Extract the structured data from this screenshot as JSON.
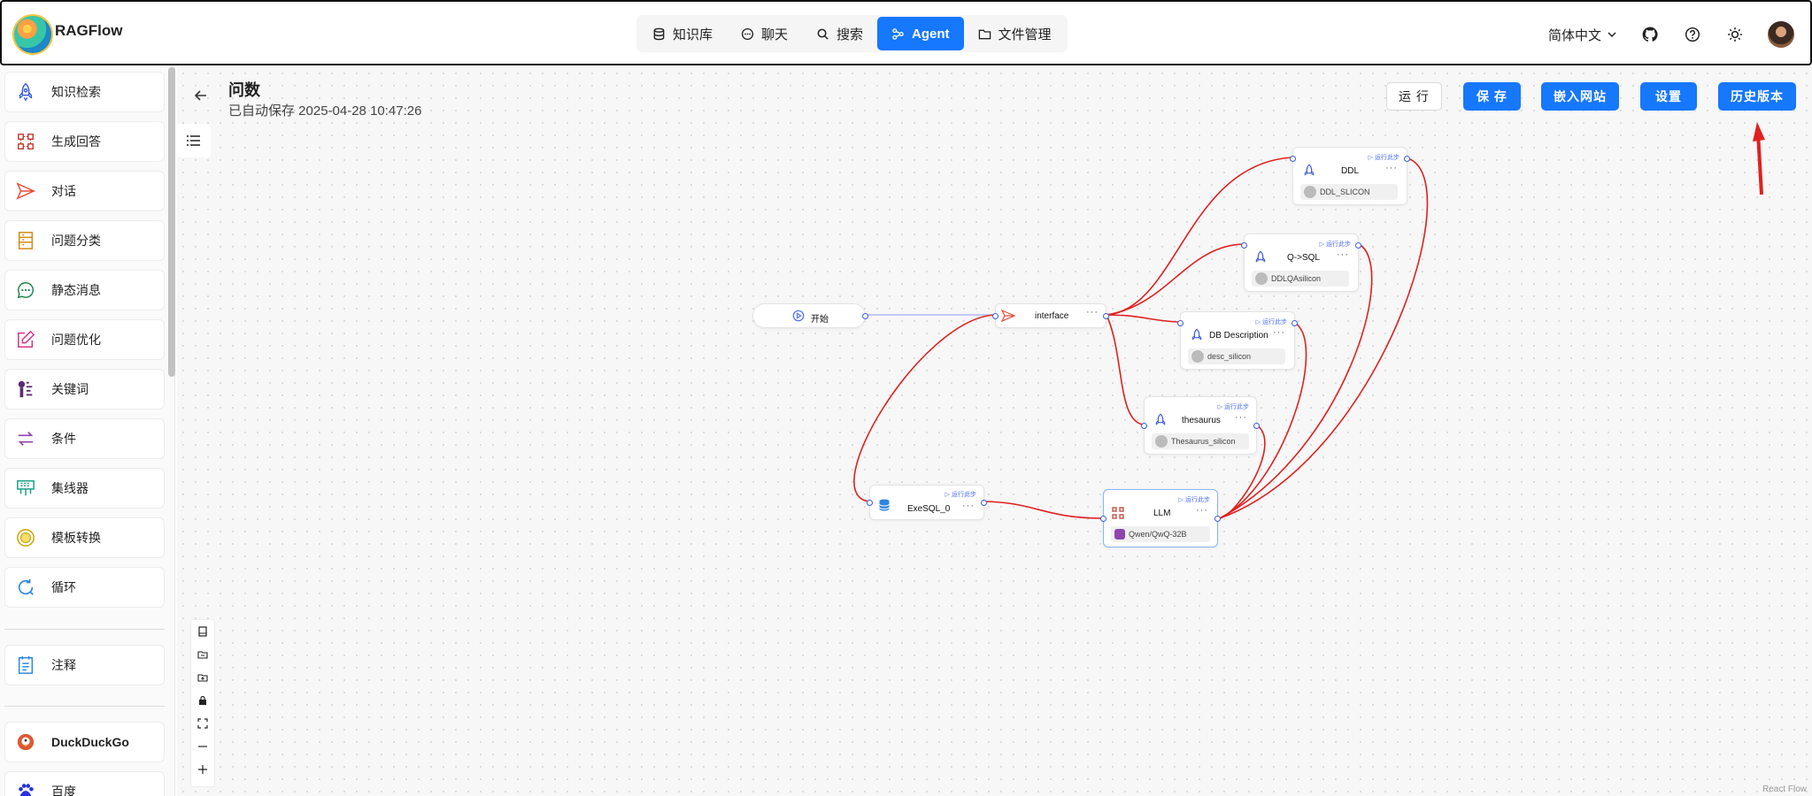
{
  "brand": "RAGFlow",
  "nav": {
    "tabs": [
      {
        "label": "知识库",
        "icon": "database-icon"
      },
      {
        "label": "聊天",
        "icon": "chat-icon"
      },
      {
        "label": "搜索",
        "icon": "search-icon"
      },
      {
        "label": "Agent",
        "icon": "agent-icon",
        "active": true
      },
      {
        "label": "文件管理",
        "icon": "folder-icon"
      }
    ]
  },
  "header_right": {
    "language": "简体中文",
    "accent": "#1677ff"
  },
  "sidebar": {
    "items": [
      {
        "label": "知识检索",
        "icon": "rocket-icon",
        "color": "#3b5bdb"
      },
      {
        "label": "生成回答",
        "icon": "generate-icon",
        "color": "#c0392b"
      },
      {
        "label": "对话",
        "icon": "send-icon",
        "color": "#e74c3c"
      },
      {
        "label": "问题分类",
        "icon": "categorize-icon",
        "color": "#d68910"
      },
      {
        "label": "静态消息",
        "icon": "message-icon",
        "color": "#1e8449"
      },
      {
        "label": "问题优化",
        "icon": "edit-icon",
        "color": "#d63384"
      },
      {
        "label": "关键词",
        "icon": "keyword-icon",
        "color": "#5b2c6f"
      },
      {
        "label": "条件",
        "icon": "switch-icon",
        "color": "#8e44ad"
      },
      {
        "label": "集线器",
        "icon": "hub-icon",
        "color": "#16a085"
      },
      {
        "label": "模板转换",
        "icon": "template-icon",
        "color": "#c9a200"
      },
      {
        "label": "循环",
        "icon": "loop-icon",
        "color": "#2e86de"
      },
      {
        "label": "注释",
        "icon": "note-icon",
        "color": "#2e86de"
      },
      {
        "label": "DuckDuckGo",
        "icon": "duckduckgo-icon",
        "color": "#de5833"
      },
      {
        "label": "百度",
        "icon": "baidu-icon",
        "color": "#2932e1"
      }
    ]
  },
  "flow": {
    "title": "问数",
    "autosave": "已自动保存 2025-04-28 10:47:26",
    "buttons": {
      "run": "运 行",
      "save": "保 存",
      "embed": "嵌入网站",
      "settings": "设置",
      "history": "历史版本"
    },
    "run_step_label": "运行此步",
    "nodes": {
      "begin": {
        "label": "开始"
      },
      "interface": {
        "label": "interface"
      },
      "ddl": {
        "label": "DDL",
        "sub": "DDL_SLICON"
      },
      "qsql": {
        "label": "Q->SQL",
        "sub": "DDLQAsilicon"
      },
      "dbdesc": {
        "label": "DB Description",
        "sub": "desc_silicon"
      },
      "thesaurus": {
        "label": "thesaurus",
        "sub": "Thesaurus_silicon"
      },
      "exesql": {
        "label": "ExeSQL_0"
      },
      "llm": {
        "label": "LLM",
        "sub": "Qwen/QwQ-32B"
      }
    },
    "watermark": "React Flow"
  }
}
